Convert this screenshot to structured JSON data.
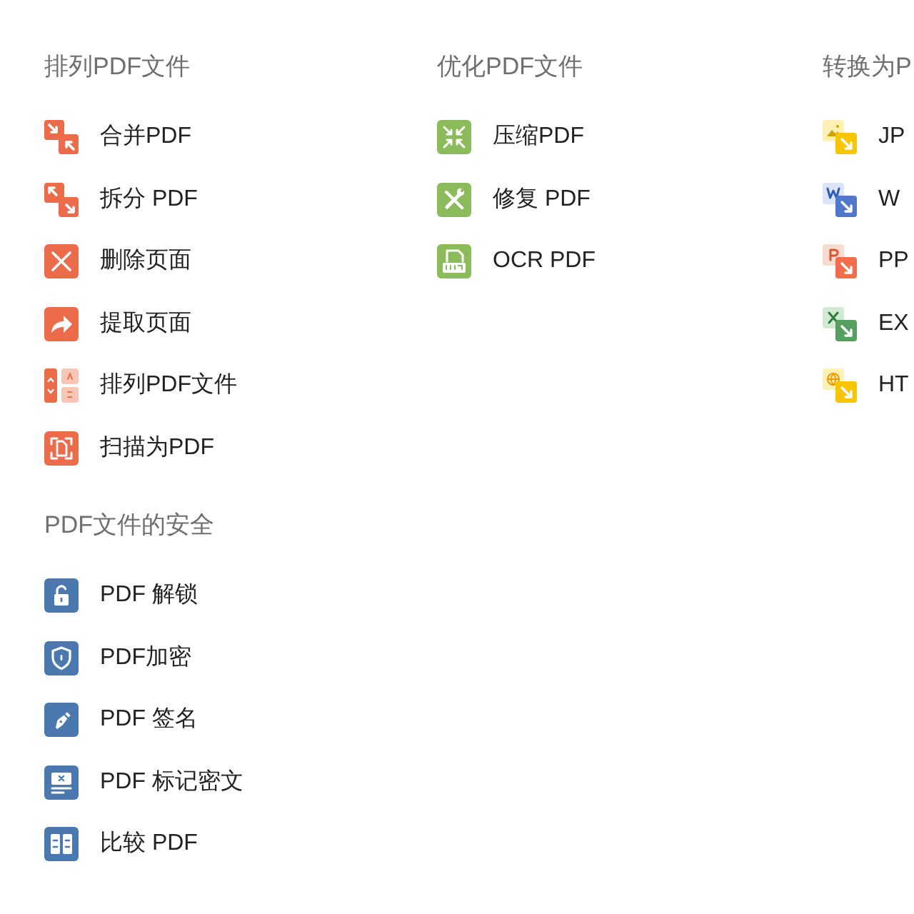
{
  "columns": [
    {
      "sections": [
        {
          "title": "排列PDF文件",
          "items": [
            {
              "label": "合并PDF",
              "kind": "merge"
            },
            {
              "label": "拆分 PDF",
              "kind": "split"
            },
            {
              "label": "删除页面",
              "kind": "delete"
            },
            {
              "label": "提取页面",
              "kind": "extract"
            },
            {
              "label": "排列PDF文件",
              "kind": "sort"
            },
            {
              "label": "扫描为PDF",
              "kind": "scan"
            }
          ]
        },
        {
          "title": "PDF文件的安全",
          "items": [
            {
              "label": "PDF 解锁",
              "kind": "unlock"
            },
            {
              "label": "PDF加密",
              "kind": "protect"
            },
            {
              "label": "PDF 签名",
              "kind": "sign"
            },
            {
              "label": "PDF 标记密文",
              "kind": "redact"
            },
            {
              "label": "比较 PDF",
              "kind": "compare"
            }
          ]
        }
      ]
    },
    {
      "sections": [
        {
          "title": "优化PDF文件",
          "items": [
            {
              "label": "压缩PDF",
              "kind": "compress"
            },
            {
              "label": "修复 PDF",
              "kind": "repair"
            },
            {
              "label": "OCR PDF",
              "kind": "ocr"
            }
          ]
        }
      ]
    },
    {
      "sections": [
        {
          "title": "转换为P",
          "items": [
            {
              "label": "JP",
              "kind": "to_image"
            },
            {
              "label": "W",
              "kind": "to_word"
            },
            {
              "label": "PP",
              "kind": "to_ppt"
            },
            {
              "label": "EX",
              "kind": "to_excel"
            },
            {
              "label": "HT",
              "kind": "to_html"
            }
          ]
        }
      ]
    }
  ]
}
